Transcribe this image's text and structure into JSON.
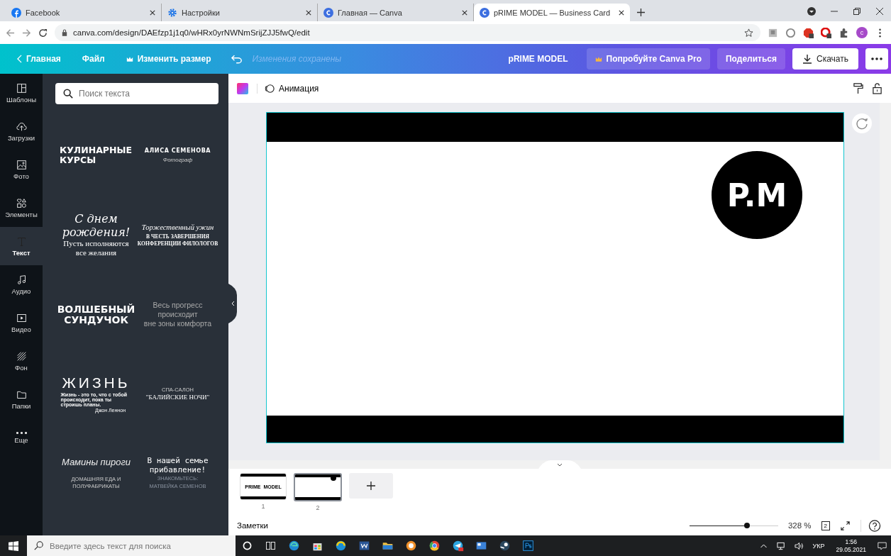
{
  "browser": {
    "tabs": [
      {
        "title": "Facebook",
        "kind": "facebook",
        "selected": false
      },
      {
        "title": "Настройки",
        "kind": "gear",
        "selected": false
      },
      {
        "title": "Главная — Canva",
        "kind": "canva",
        "selected": false
      },
      {
        "title": "pRIME MODEL — Business Card",
        "kind": "canva",
        "selected": true
      }
    ],
    "url": "canva.com/design/DAEfzp1j1q0/wHRx0yrNWNmSrijZJJ5fwQ/edit",
    "profile": "c"
  },
  "topbar": {
    "home": "Главная",
    "file": "Файл",
    "resize": "Изменить размер",
    "status": "Изменения сохранены",
    "design_title": "pRIME MODEL",
    "try_pro": "Попробуйте Canva Pro",
    "share": "Поделиться",
    "download": "Скачать"
  },
  "rail": [
    {
      "label": "Шаблоны",
      "kind": "templates",
      "selected": false
    },
    {
      "label": "Загрузки",
      "kind": "uploads",
      "selected": false
    },
    {
      "label": "Фото",
      "kind": "photos",
      "selected": false
    },
    {
      "label": "Элементы",
      "kind": "elements",
      "selected": false
    },
    {
      "label": "Текст",
      "kind": "text",
      "selected": true
    },
    {
      "label": "Аудио",
      "kind": "audio",
      "selected": false
    },
    {
      "label": "Видео",
      "kind": "video",
      "selected": false
    },
    {
      "label": "Фон",
      "kind": "background",
      "selected": false
    },
    {
      "label": "Папки",
      "kind": "folders",
      "selected": false
    },
    {
      "label": "Еще",
      "kind": "more",
      "selected": false
    }
  ],
  "text_panel": {
    "search": {
      "placeholder": "Поиск текста"
    },
    "cards": [
      {
        "lines": [
          {
            "text": "КУЛИНАРНЫЕ",
            "kind": "heavyleft"
          },
          {
            "text": "КУРСЫ",
            "kind": "heavyleft"
          }
        ]
      },
      {
        "lines": [
          {
            "text": "АЛИСА СЕМЕНОВА",
            "kind": "capswide"
          },
          {
            "text": "Фотограф",
            "kind": "tinyitalic"
          }
        ]
      },
      {
        "lines": [
          {
            "text": "С днем",
            "kind": "script"
          },
          {
            "text": "рождения!",
            "kind": "script"
          },
          {
            "text": "Пусть исполняются",
            "kind": "serif"
          },
          {
            "text": "все желания",
            "kind": "serif"
          }
        ]
      },
      {
        "lines": [
          {
            "text": "Торжественный ужин",
            "kind": "italicserif"
          },
          {
            "text": "В ЧЕСТЬ ЗАВЕРШЕНИЯ",
            "kind": "tinyserif"
          },
          {
            "text": "КОНФЕРЕНЦИИ ФИЛОЛОГОВ",
            "kind": "tinyserif"
          }
        ]
      },
      {
        "lines": [
          {
            "text": "ВОЛШЕБНЫЙ",
            "kind": "heavy"
          },
          {
            "text": "СУНДУЧОК",
            "kind": "heavy"
          }
        ]
      },
      {
        "lines": [
          {
            "text": "Весь прогресс",
            "kind": "thin"
          },
          {
            "text": "происходит",
            "kind": "thin"
          },
          {
            "text": "вне зоны комфорта",
            "kind": "thin"
          }
        ]
      },
      {
        "lines": [
          {
            "text": "ЖИЗНЬ",
            "kind": "widethin"
          },
          {
            "text": "Жизнь - это то, что с тобой происходит, пока ты строишь планы.",
            "kind": "smallleft"
          },
          {
            "text": "Джон Леннон",
            "kind": "smallright"
          }
        ]
      },
      {
        "lines": [
          {
            "text": "СПА-САЛОН",
            "kind": "tiny"
          },
          {
            "text": "\"БАЛИЙСКИЕ НОЧИ\"",
            "kind": "serifcaps"
          }
        ]
      },
      {
        "lines": [
          {
            "text": "Мамины пироги",
            "kind": "italic"
          },
          {
            "text": "ДОМАШНЯЯ ЕДА И",
            "kind": "tiny"
          },
          {
            "text": "ПОЛУФАБРИКАТЫ",
            "kind": "tiny"
          }
        ]
      },
      {
        "lines": [
          {
            "text": "В нашей семье",
            "kind": "hand"
          },
          {
            "text": "прибавление!",
            "kind": "hand"
          },
          {
            "text": "ЗНАКОМЬТЕСЬ:",
            "kind": "faint"
          },
          {
            "text": "МАТВЕЙКА СЕМЕНОВ",
            "kind": "faint"
          }
        ]
      }
    ]
  },
  "editor": {
    "animation": "Анимация",
    "logo": "P.M",
    "pages": [
      {
        "number": "1",
        "thumb_text": "PRIME  MODEL",
        "selected": false
      },
      {
        "number": "2",
        "selected": true
      }
    ],
    "notes": "Заметки",
    "zoom": {
      "level": 0.65,
      "reading": "328 %"
    },
    "page_count": "2"
  },
  "taskbar": {
    "search": {
      "placeholder": "Введите здесь текст для поиска"
    },
    "language": "УКР",
    "time": "1:56",
    "date": "29.05.2021"
  }
}
